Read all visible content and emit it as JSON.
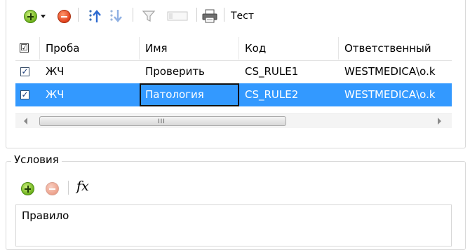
{
  "toolbar": {
    "title": "Тест",
    "icons": [
      "add-icon",
      "dropdown-arrow-icon",
      "remove-icon",
      "move-up-icon",
      "move-down-icon",
      "filter-icon",
      "filter-field-icon",
      "print-icon"
    ]
  },
  "grid": {
    "columns": [
      "Проба",
      "Имя",
      "Код",
      "Ответственный"
    ],
    "header_check": "☑",
    "rows": [
      {
        "checked": "✓",
        "proba": "ЖЧ",
        "name": "Проверить",
        "code": "CS_RULE1",
        "owner": "WESTMEDICA\\o.k"
      },
      {
        "checked": "✓",
        "proba": "ЖЧ",
        "name": "Патология",
        "code": "CS_RULE2",
        "owner": "WESTMEDICA\\o.k"
      }
    ],
    "selected_row": 1,
    "scroll_grip": "III"
  },
  "conditions": {
    "legend": "Условия",
    "fx_label": "fx",
    "rule_header": "Правило"
  },
  "colors": {
    "selection": "#3399ff",
    "add": "#6fb21c",
    "remove": "#e1401c"
  }
}
